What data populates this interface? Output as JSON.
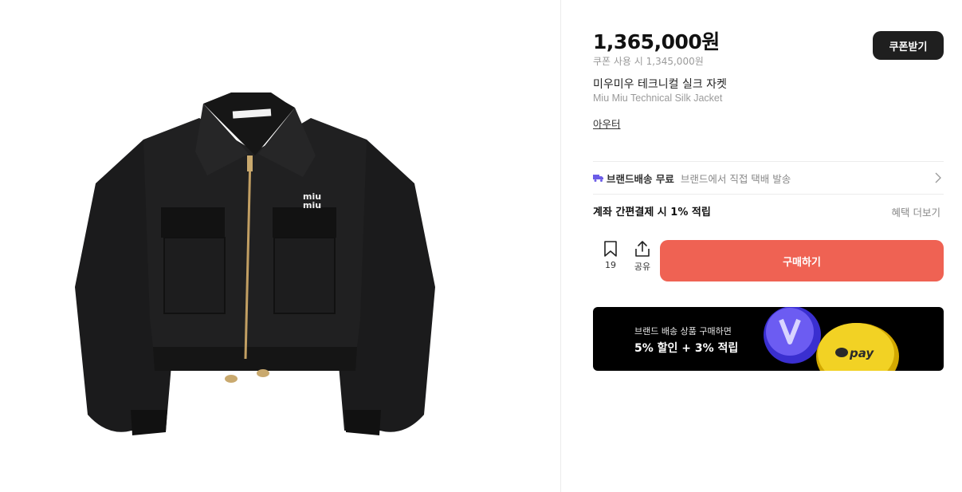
{
  "product": {
    "price": "1,365,000원",
    "coupon_price": "쿠폰 사용 시 1,345,000원",
    "coupon_button": "쿠폰받기",
    "name_ko": "미우미우 테크니컬 실크 자켓",
    "name_en": "Miu Miu Technical Silk Jacket",
    "category": "아우터",
    "image_icon": "black-jacket-image",
    "brand_logo_text": "miu miu"
  },
  "shipping": {
    "icon": "truck-icon",
    "label": "브랜드배송 무료",
    "description": "브랜드에서 직접 택배 발송"
  },
  "benefit": {
    "label": "계좌 간편결제 시 1% 적립",
    "more": "혜택 더보기"
  },
  "actions": {
    "bookmark_count": "19",
    "share_label": "공유",
    "buy_label": "구매하기"
  },
  "banner": {
    "line1": "브랜드 배송 상품 구매하면",
    "line2": "5% 할인 + 3% 적립",
    "coin_text": "pay"
  },
  "colors": {
    "buy_button": "#ef6253",
    "coupon_button": "#1f1f1f",
    "truck_icon": "#6b5ce7",
    "banner_bg": "#000000"
  }
}
